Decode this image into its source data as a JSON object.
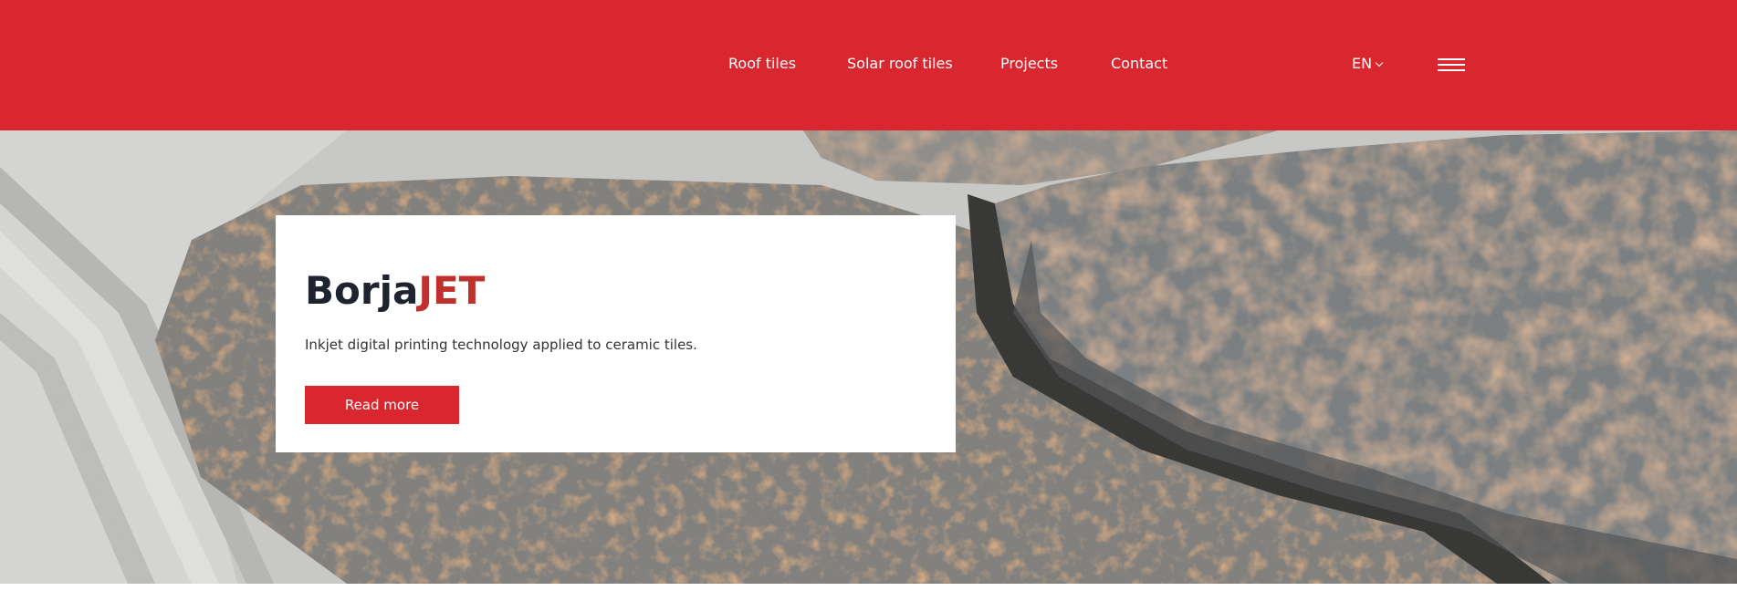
{
  "header": {
    "nav": [
      {
        "label": "Roof tiles"
      },
      {
        "label": "Solar roof tiles"
      },
      {
        "label": "Projects"
      },
      {
        "label": "Contact"
      }
    ],
    "language": "EN"
  },
  "hero": {
    "title_main": "Borja",
    "title_accent": "JET",
    "description": "Inkjet digital printing technology applied to ceramic tiles.",
    "button_label": "Read more"
  },
  "colors": {
    "brand_red": "#d9262f",
    "title_dark": "#1f2330",
    "title_accent": "#c0302c"
  },
  "icons": {
    "menu": "hamburger-menu-icon",
    "language": "chevron-down-icon"
  }
}
